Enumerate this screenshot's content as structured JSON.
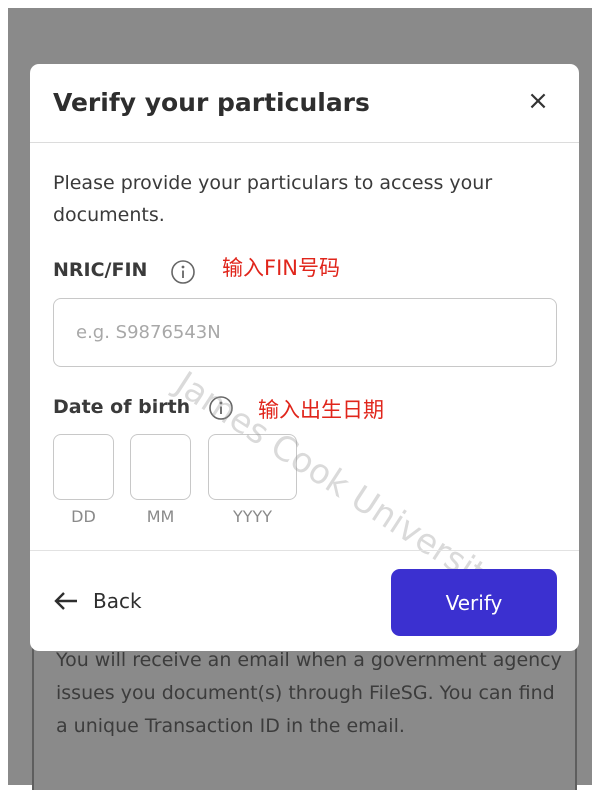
{
  "modal": {
    "title": "Verify your particulars",
    "close_label": "×",
    "intro": "Please provide your particulars to access your documents.",
    "nric": {
      "label": "NRIC/FIN",
      "placeholder": "e.g. S9876543N",
      "value": "",
      "annotation": "输入FIN号码"
    },
    "dob": {
      "label": "Date of birth",
      "annotation": "输入出生日期",
      "fields": [
        "DD",
        "MM",
        "YYYY"
      ],
      "values": [
        "",
        "",
        ""
      ]
    },
    "footer": {
      "back_label": "Back",
      "verify_label": "Verify"
    }
  },
  "watermark": "James Cook University",
  "background_text": "You will receive an email when a government agency issues you document(s) through FileSG. You can find a unique Transaction ID in the email.",
  "colors": {
    "primary": "#3b30d0",
    "annotation": "#e0251b",
    "overlay": "#8a8a8a"
  }
}
